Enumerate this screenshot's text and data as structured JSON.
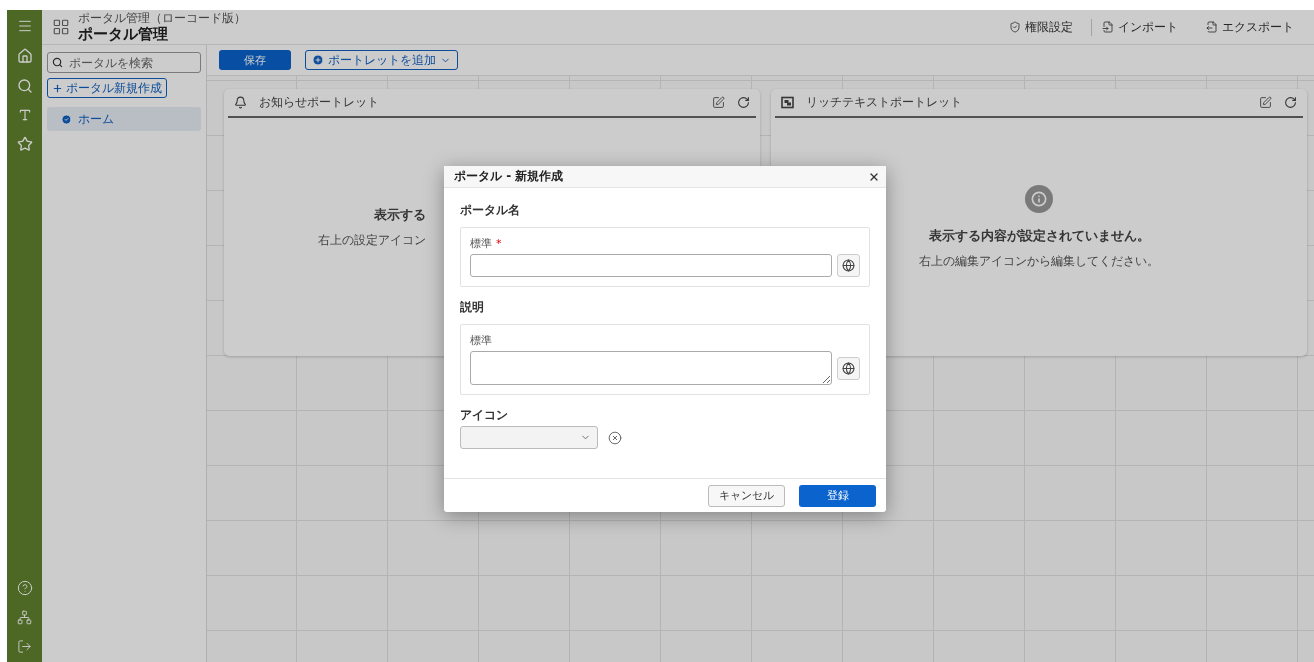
{
  "header": {
    "subtitle": "ポータル管理（ローコード版）",
    "title": "ポータル管理",
    "actions": [
      {
        "label": "権限設定",
        "kind": "permissions"
      },
      {
        "label": "インポート",
        "kind": "import"
      },
      {
        "label": "エクスポート",
        "kind": "export"
      }
    ]
  },
  "sidebar": {
    "search_placeholder": "ポータルを検索",
    "new_button": "ポータル新規作成",
    "items": [
      {
        "label": "ホーム",
        "selected": true
      }
    ]
  },
  "toolbar": {
    "save": "保存",
    "add_portlet": "ポートレットを追加"
  },
  "portlets": [
    {
      "title": "お知らせポートレット",
      "kind": "notice",
      "message": "表示する",
      "hint": "右上の設定アイコン",
      "info_icon": false
    },
    {
      "title": "リッチテキストポートレット",
      "kind": "richtext",
      "message": "表示する内容が設定されていません。",
      "hint": "右上の編集アイコンから編集してください。",
      "info_icon": true
    }
  ],
  "dialog": {
    "title": "ポータル - 新規作成",
    "sections": [
      {
        "label": "ポータル名",
        "field_label": "標準",
        "required_mark": "*",
        "kind": "input"
      },
      {
        "label": "説明",
        "field_label": "標準",
        "kind": "textarea"
      }
    ],
    "icon_label": "アイコン",
    "cancel": "キャンセル",
    "submit": "登録"
  }
}
